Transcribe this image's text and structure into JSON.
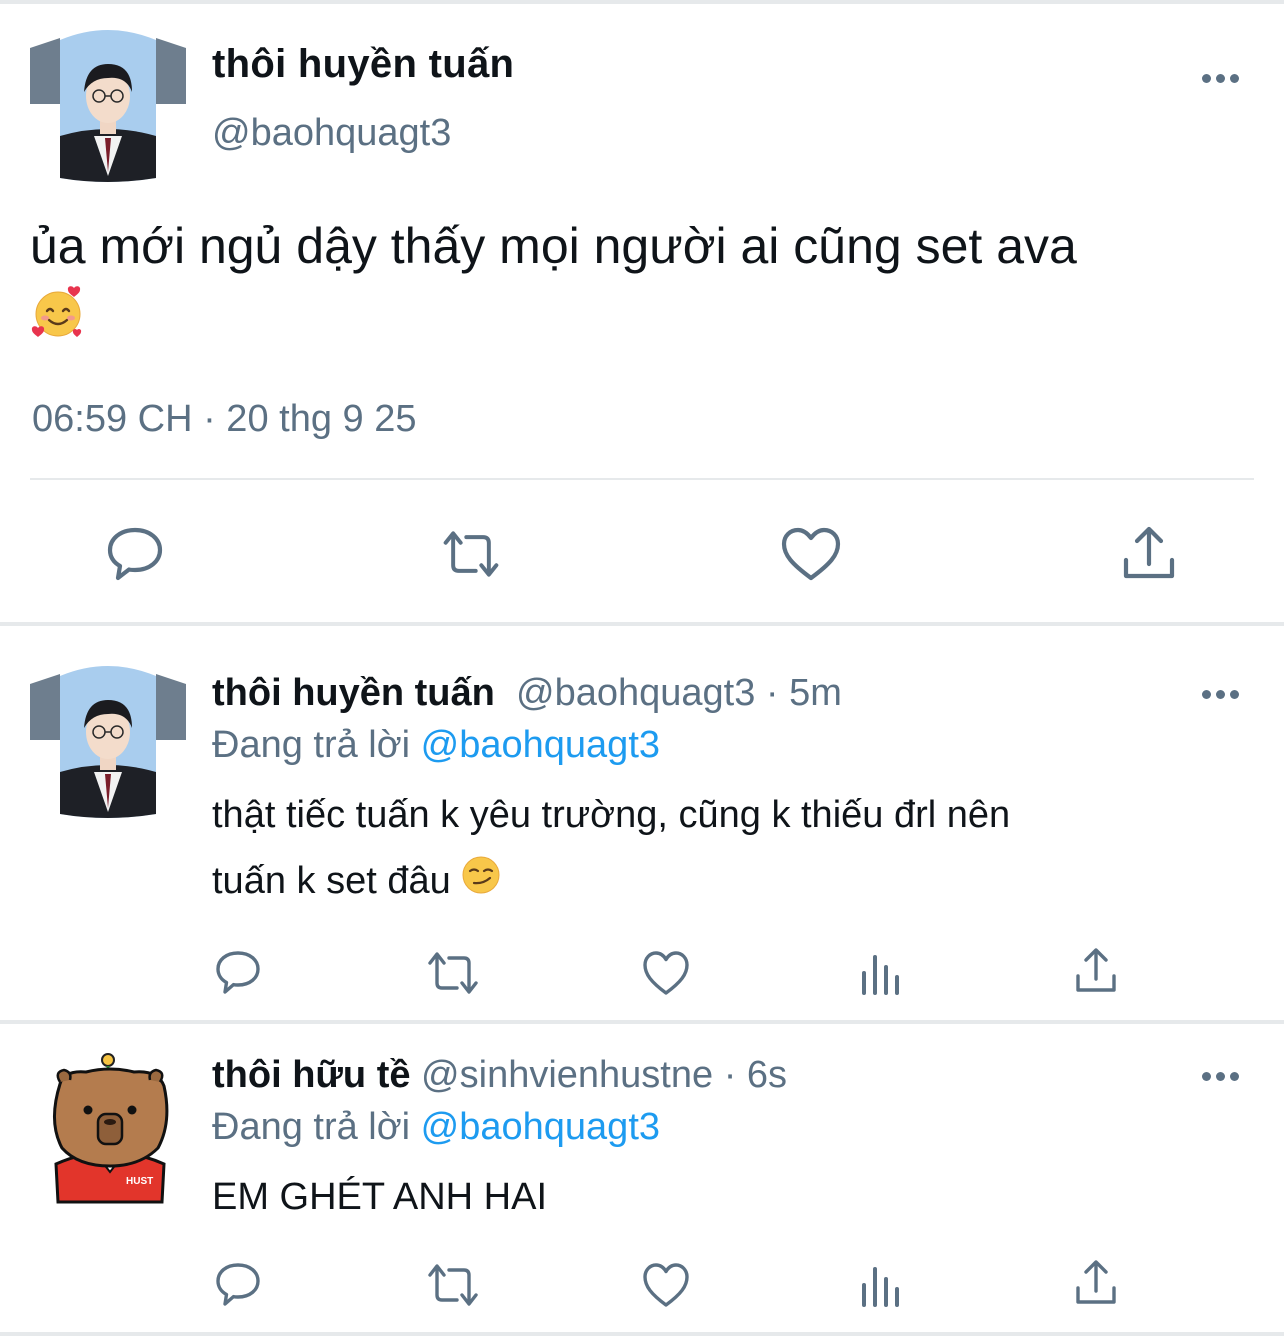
{
  "main_tweet": {
    "display_name": "thôi huyền tuấn",
    "handle": "@baohquagt3",
    "text": "ủa mới ngủ dậy thấy mọi người ai cũng set ava",
    "emoji": "smiling-face-with-hearts",
    "timestamp": "06:59 CH · 20 thg 9 25"
  },
  "replies": [
    {
      "display_name": "thôi huyền tuấn",
      "handle": "@baohquagt3",
      "separator": "·",
      "age": "5m",
      "replying_label": "Đang trả lời",
      "replying_to": "@baohquagt3",
      "text_line1": "thật tiếc tuấn k yêu trường, cũng k thiếu đrl nên",
      "text_line2": "tuấn k set đâu",
      "emoji": "smirking-face"
    },
    {
      "display_name": "thôi hữu tề",
      "handle": "@sinhvienhustne",
      "separator": "·",
      "age": "6s",
      "replying_label": "Đang trả lời",
      "replying_to": "@baohquagt3",
      "text_line1": "EM GHÉT ANH HAI",
      "avatar_badge": "HUST"
    }
  ],
  "colors": {
    "text": "#0f1419",
    "secondary": "#5b7083",
    "link": "#1d9bf0",
    "divider": "#e6e9eb"
  }
}
